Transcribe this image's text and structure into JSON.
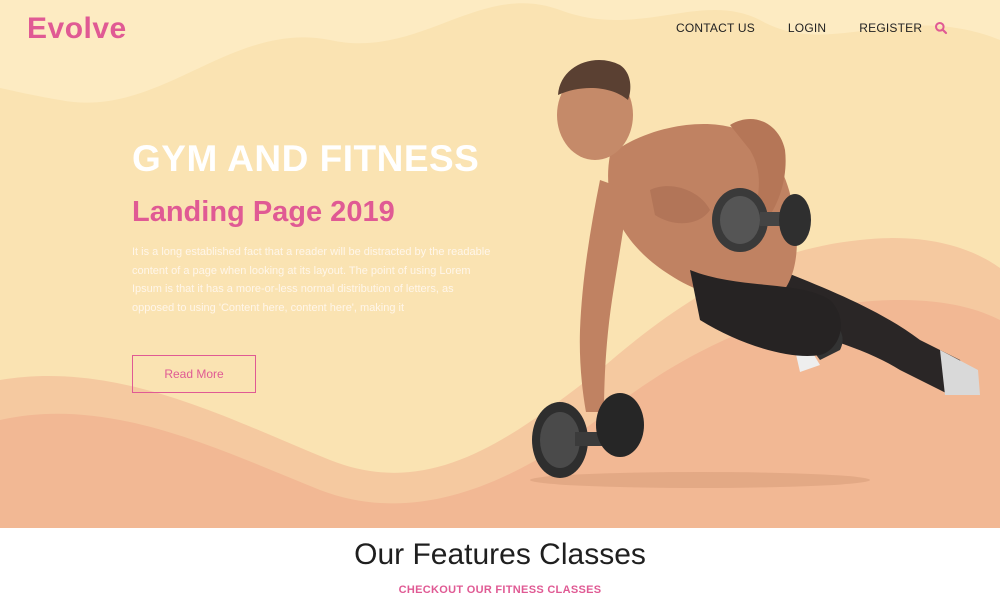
{
  "brand": {
    "logo": "Evolve",
    "accent": "#e05a94"
  },
  "nav": {
    "items": [
      "CONTACT US",
      "LOGIN",
      "REGISTER"
    ],
    "search_icon": "search-icon"
  },
  "hero": {
    "title": "GYM AND FITNESS",
    "subtitle": "Landing Page 2019",
    "description": "It is a long established fact that a reader will be distracted by the readable content of a page when looking at its layout. The point of using Lorem Ipsum is that it has a more-or-less normal distribution of letters, as opposed to using 'Content here, content here', making it",
    "button": "Read More",
    "colors": {
      "background": "#fae3b2",
      "wave": "#f2b894"
    }
  },
  "features": {
    "title": "Our Features Classes",
    "subtitle": "CHECKOUT OUR FITNESS CLASSES"
  }
}
